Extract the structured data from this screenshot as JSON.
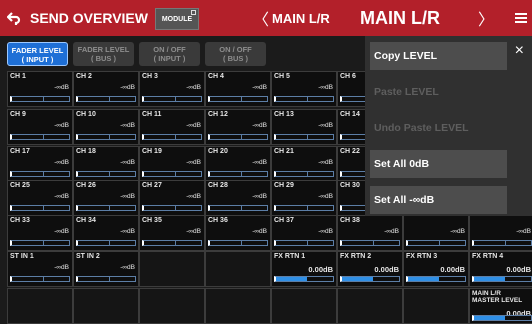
{
  "header": {
    "back_icon": "back-arrow-icon",
    "title": "SEND OVERVIEW",
    "module_label": "MODULE",
    "selected_small": "MAIN L/R",
    "selected_big": "MAIN L/R",
    "prev_symbol": "〈",
    "next_symbol": "〉",
    "menu_icon": "hamburger-menu-icon"
  },
  "tabs": [
    {
      "line1": "FADER LEVEL",
      "line2": "( INPUT )",
      "active": true
    },
    {
      "line1": "FADER LEVEL",
      "line2": "( BUS )",
      "active": false
    },
    {
      "line1": "ON / OFF",
      "line2": "( INPUT )",
      "active": false
    },
    {
      "line1": "ON / OFF",
      "line2": "( BUS )",
      "active": false
    }
  ],
  "channels": {
    "row1": [
      {
        "label": "CH 1",
        "value": "-∞dB"
      },
      {
        "label": "CH 2",
        "value": "-∞dB"
      },
      {
        "label": "CH 3",
        "value": "-∞dB"
      },
      {
        "label": "CH 4",
        "value": "-∞dB"
      },
      {
        "label": "CH 5",
        "value": "-∞dB"
      },
      {
        "label": "CH 6",
        "value": ""
      }
    ],
    "row2": [
      {
        "label": "CH 9",
        "value": "-∞dB"
      },
      {
        "label": "CH 10",
        "value": "-∞dB"
      },
      {
        "label": "CH 11",
        "value": "-∞dB"
      },
      {
        "label": "CH 12",
        "value": "-∞dB"
      },
      {
        "label": "CH 13",
        "value": "-∞dB"
      },
      {
        "label": "CH 14",
        "value": ""
      }
    ],
    "row3": [
      {
        "label": "CH 17",
        "value": "-∞dB"
      },
      {
        "label": "CH 18",
        "value": "-∞dB"
      },
      {
        "label": "CH 19",
        "value": "-∞dB"
      },
      {
        "label": "CH 20",
        "value": "-∞dB"
      },
      {
        "label": "CH 21",
        "value": "-∞dB"
      },
      {
        "label": "CH 22",
        "value": ""
      }
    ],
    "row4": [
      {
        "label": "CH 25",
        "value": "-∞dB"
      },
      {
        "label": "CH 26",
        "value": "-∞dB"
      },
      {
        "label": "CH 27",
        "value": "-∞dB"
      },
      {
        "label": "CH 28",
        "value": "-∞dB"
      },
      {
        "label": "CH 29",
        "value": "-∞dB"
      },
      {
        "label": "CH 30",
        "value": ""
      }
    ],
    "row5": [
      {
        "label": "CH 33",
        "value": "-∞dB"
      },
      {
        "label": "CH 34",
        "value": "-∞dB"
      },
      {
        "label": "CH 35",
        "value": "-∞dB"
      },
      {
        "label": "CH 36",
        "value": "-∞dB"
      },
      {
        "label": "CH 37",
        "value": "-∞dB"
      },
      {
        "label": "CH 38",
        "value": "-∞dB"
      },
      {
        "label": "",
        "value": "-∞dB"
      },
      {
        "label": "",
        "value": "-∞dB"
      }
    ],
    "row6": [
      {
        "label": "ST IN 1",
        "value": "-∞dB"
      },
      {
        "label": "ST IN 2",
        "value": "-∞dB"
      },
      {
        "label": "FX RTN 1",
        "value": "0.00dB"
      },
      {
        "label": "FX RTN 2",
        "value": "0.00dB"
      },
      {
        "label": "FX RTN 3",
        "value": "0.00dB"
      },
      {
        "label": "FX RTN 4",
        "value": "0.00dB"
      }
    ],
    "master": {
      "line1": "MAIN L/R",
      "line2": "MASTER LEVEL",
      "value": "0.00dB"
    }
  },
  "popup": {
    "items": [
      {
        "label": "Copy LEVEL",
        "enabled": true
      },
      {
        "label": "Paste LEVEL",
        "enabled": false
      },
      {
        "label": "Undo Paste LEVEL",
        "enabled": false
      },
      {
        "label": "Set All 0dB",
        "enabled": true
      },
      {
        "label": "Set All -∞dB",
        "enabled": true
      }
    ],
    "close_symbol": "×"
  },
  "colors": {
    "header": "#b3202a",
    "active_tab": "#1e6fd6",
    "meter_fill": "#2f8fe6",
    "popup_bg": "#303030"
  }
}
